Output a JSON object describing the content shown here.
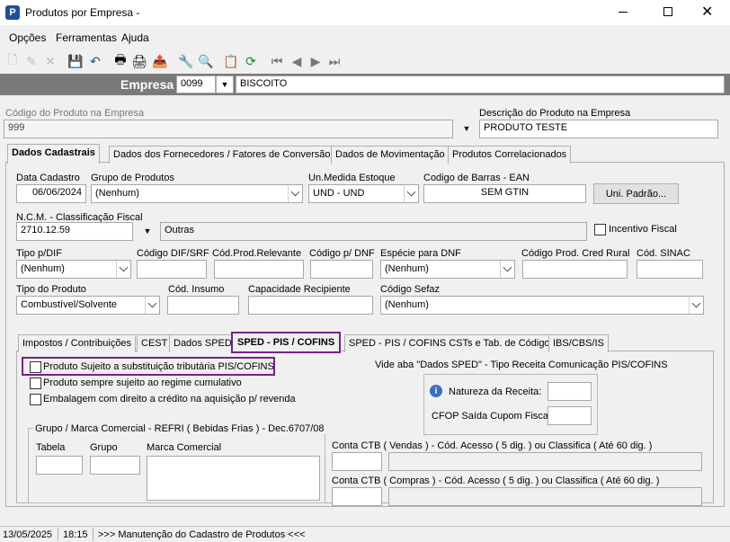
{
  "window": {
    "title": "Produtos por Empresa -",
    "logo": "P"
  },
  "menu": [
    "Opções",
    "Ferramentas",
    "Ajuda"
  ],
  "empresa": {
    "label": "Empresa",
    "code": "0099",
    "name": "BISCOITO"
  },
  "produto": {
    "codigo_label": "Código do Produto na Empresa",
    "codigo_value": "999",
    "descricao_label": "Descrição do Produto na Empresa",
    "descricao_value": "PRODUTO TESTE"
  },
  "main_tabs": [
    "Dados Cadastrais",
    "Dados dos Fornecedores / Fatores de Conversão",
    "Dados de Movimentação",
    "Produtos Correlacionados"
  ],
  "form": {
    "data_cadastro_label": "Data Cadastro",
    "data_cadastro": "06/06/2024",
    "grupo_label": "Grupo de Produtos",
    "grupo": "(Nenhum)",
    "unidade_label": "Un.Medida Estoque",
    "unidade": "UND - UND",
    "ean_label": "Codigo de Barras - EAN",
    "ean": "SEM GTIN",
    "uni_padrao_btn": "Uni. Padrão...",
    "ncm_label": "N.C.M. -  Classificação Fiscal",
    "ncm": "2710.12.59",
    "ncm_desc": "Outras",
    "incentivo_label": "Incentivo Fiscal",
    "tipo_dif_label": "Tipo p/DIF",
    "tipo_dif": "(Nenhum)",
    "codigo_dif_label": "Código DIF/SRF",
    "cod_relevante_label": "Cód.Prod.Relevante",
    "codigo_dnf_label": "Código p/ DNF",
    "especie_dnf_label": "Espécie para DNF",
    "especie_dnf": "(Nenhum)",
    "cred_rural_label": "Código Prod. Cred Rural",
    "sinac_label": "Cód. SINAC",
    "tipo_produto_label": "Tipo do Produto",
    "tipo_produto": "Combustível/Solvente",
    "cod_insumo_label": "Cód. Insumo",
    "capacidade_label": "Capacidade Recipiente",
    "sefaz_label": "Código Sefaz",
    "sefaz": "(Nenhum)"
  },
  "sub_tabs": [
    "Impostos / Contribuições",
    "CEST",
    "Dados SPED",
    "SPED - PIS / COFINS",
    "SPED - PIS / COFINS CSTs e Tab. de Códigos",
    "IBS/CBS/IS"
  ],
  "pis": {
    "check1": "Produto Sujeito a substituição tributária PIS/COFINS",
    "check2": "Produto sempre sujeito ao regime cumulativo",
    "check3": "Embalagem com direito a crédito na aquisição p/ revenda",
    "vide": "Vide aba \"Dados SPED\" - Tipo Receita Comunicação PIS/COFINS",
    "natureza_label": "Natureza da Receita:",
    "cfop_label": "CFOP Saída Cupom Fiscal:",
    "grupo_title": "Grupo / Marca Comercial - REFRI ( Bebidas Frias ) - Dec.6707/08",
    "tabela_label": "Tabela",
    "grupo_label": "Grupo",
    "marca_label": "Marca Comercial",
    "ctb_vendas_label": "Conta CTB ( Vendas ) - Cód. Acesso ( 5 dig. ) ou Classifica ( Até 60 dig. )",
    "ctb_compras_label": "Conta CTB ( Compras ) - Cód. Acesso ( 5 dig. ) ou Classifica ( Até 60 dig. )"
  },
  "status": {
    "date": "13/05/2025",
    "time": "18:15",
    "message": ">>> Manutenção do Cadastro de Produtos <<<"
  },
  "colors": {
    "accent": "#7a1f8c",
    "empresa_bar": "#7a7a7a",
    "logo": "#1f4e9a"
  }
}
